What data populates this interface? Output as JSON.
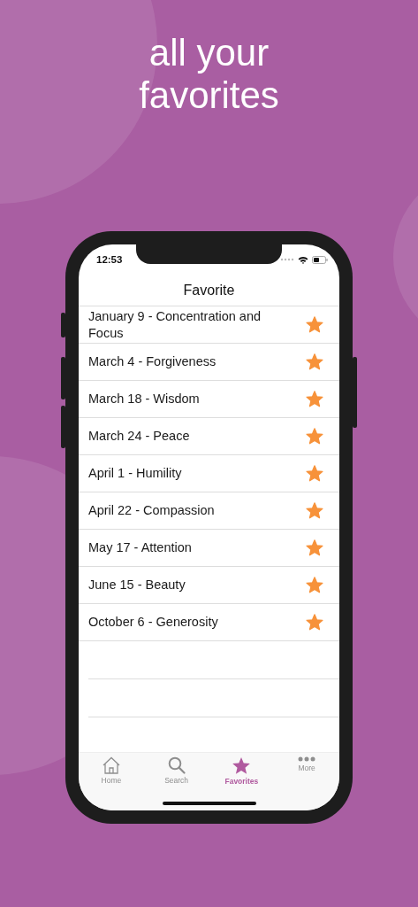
{
  "headline": "all your favorites",
  "status_bar": {
    "time": "12:53"
  },
  "nav_bar": {
    "title": "Favorite"
  },
  "favorites": [
    {
      "title": "January 9 - Concentration and Focus",
      "starred": true
    },
    {
      "title": "March 4 - Forgiveness",
      "starred": true
    },
    {
      "title": "March 18 - Wisdom",
      "starred": true
    },
    {
      "title": "March 24 - Peace",
      "starred": true
    },
    {
      "title": "April 1 - Humility",
      "starred": true
    },
    {
      "title": "April 22 - Compassion",
      "starred": true
    },
    {
      "title": "May 17 - Attention",
      "starred": true
    },
    {
      "title": "June 15 - Beauty",
      "starred": true
    },
    {
      "title": "October 6 - Generosity",
      "starred": true
    }
  ],
  "tab_bar": [
    {
      "label": "Home",
      "kind": "home",
      "selected": false
    },
    {
      "label": "Search",
      "kind": "search",
      "selected": false
    },
    {
      "label": "Favorites",
      "kind": "star",
      "selected": true
    },
    {
      "label": "More",
      "kind": "more",
      "selected": false
    }
  ]
}
